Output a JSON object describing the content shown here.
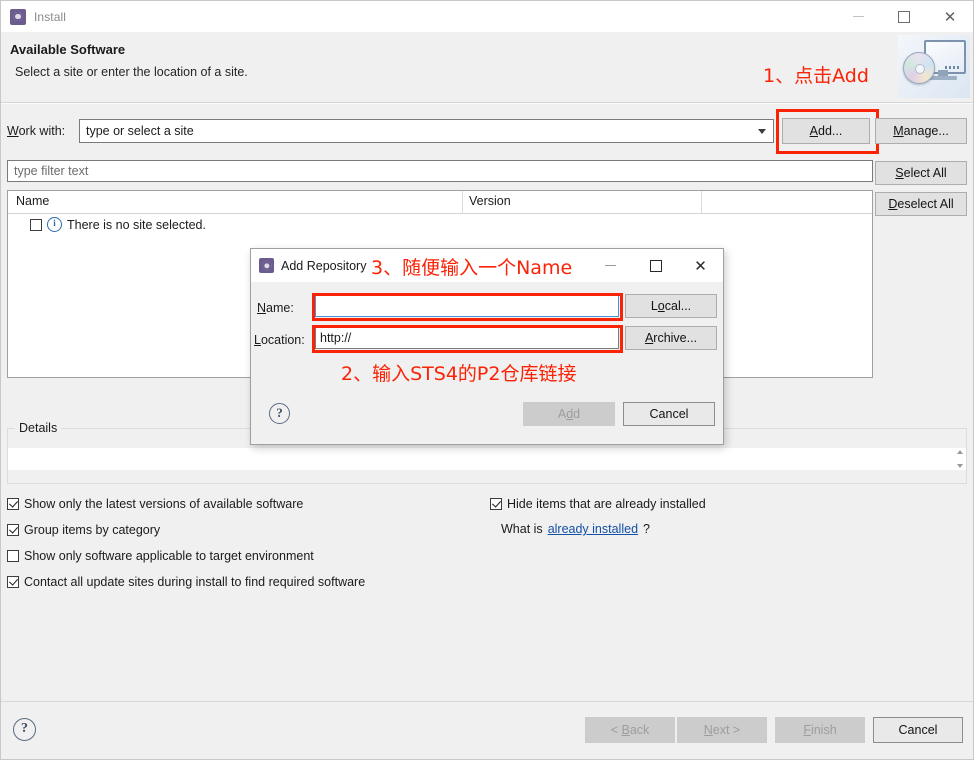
{
  "window": {
    "title": "Install",
    "icon": "eclipse-install-icon",
    "controls": {
      "minimize": "—",
      "maximize": "□",
      "close": "✕"
    }
  },
  "header": {
    "title": "Available Software",
    "subtitle": "Select a site or enter the location of a site.",
    "banner_icon": "monitor-with-cd-icon"
  },
  "work_with": {
    "label_prefix": "W",
    "label_rest": "ork with:",
    "value": "type or select a site",
    "dropdown_icon": "chevron-down-icon"
  },
  "buttons": {
    "add": "Add...",
    "manage": "Manage...",
    "select_all": "Select All",
    "deselect_all": "Deselect All"
  },
  "filter": {
    "placeholder": "type filter text"
  },
  "table": {
    "columns": [
      "Name",
      "Version"
    ],
    "rows": [
      {
        "checked": false,
        "icon": "info-icon",
        "label": "There is no site selected."
      }
    ]
  },
  "details": {
    "legend": "Details",
    "value": "",
    "scroll_up_icon": "triangle-up-icon",
    "scroll_down_icon": "triangle-down-icon"
  },
  "options": {
    "left": [
      {
        "checked": true,
        "label": "Show only the latest versions of available software"
      },
      {
        "checked": true,
        "label": "Group items by category"
      },
      {
        "checked": false,
        "label": "Show only software applicable to target environment"
      },
      {
        "checked": true,
        "label": "Contact all update sites during install to find required software"
      }
    ],
    "right": [
      {
        "checked": true,
        "label": "Hide items that are already installed"
      }
    ],
    "what_is_prefix": "What is ",
    "what_is_link": "already installed",
    "what_is_suffix": "?"
  },
  "footer": {
    "help_icon": "question-mark-icon",
    "back": "< Back",
    "next": "Next >",
    "finish": "Finish",
    "cancel": "Cancel"
  },
  "dialog": {
    "title": "Add Repository",
    "icon": "eclipse-install-icon",
    "controls": {
      "minimize": "—",
      "maximize": "□",
      "close": "✕"
    },
    "name_label": "Name:",
    "name_value": "",
    "location_label": "Location:",
    "location_value": "http://",
    "local_button": "Local...",
    "archive_button": "Archive...",
    "help_icon": "question-mark-icon",
    "add_button": "Add",
    "cancel_button": "Cancel"
  },
  "annotations": {
    "step1": "1、点击Add",
    "step2": "2、输入STS4的P2仓库链接",
    "step3": "3、随便输入一个Name",
    "color": "#fa2306"
  }
}
